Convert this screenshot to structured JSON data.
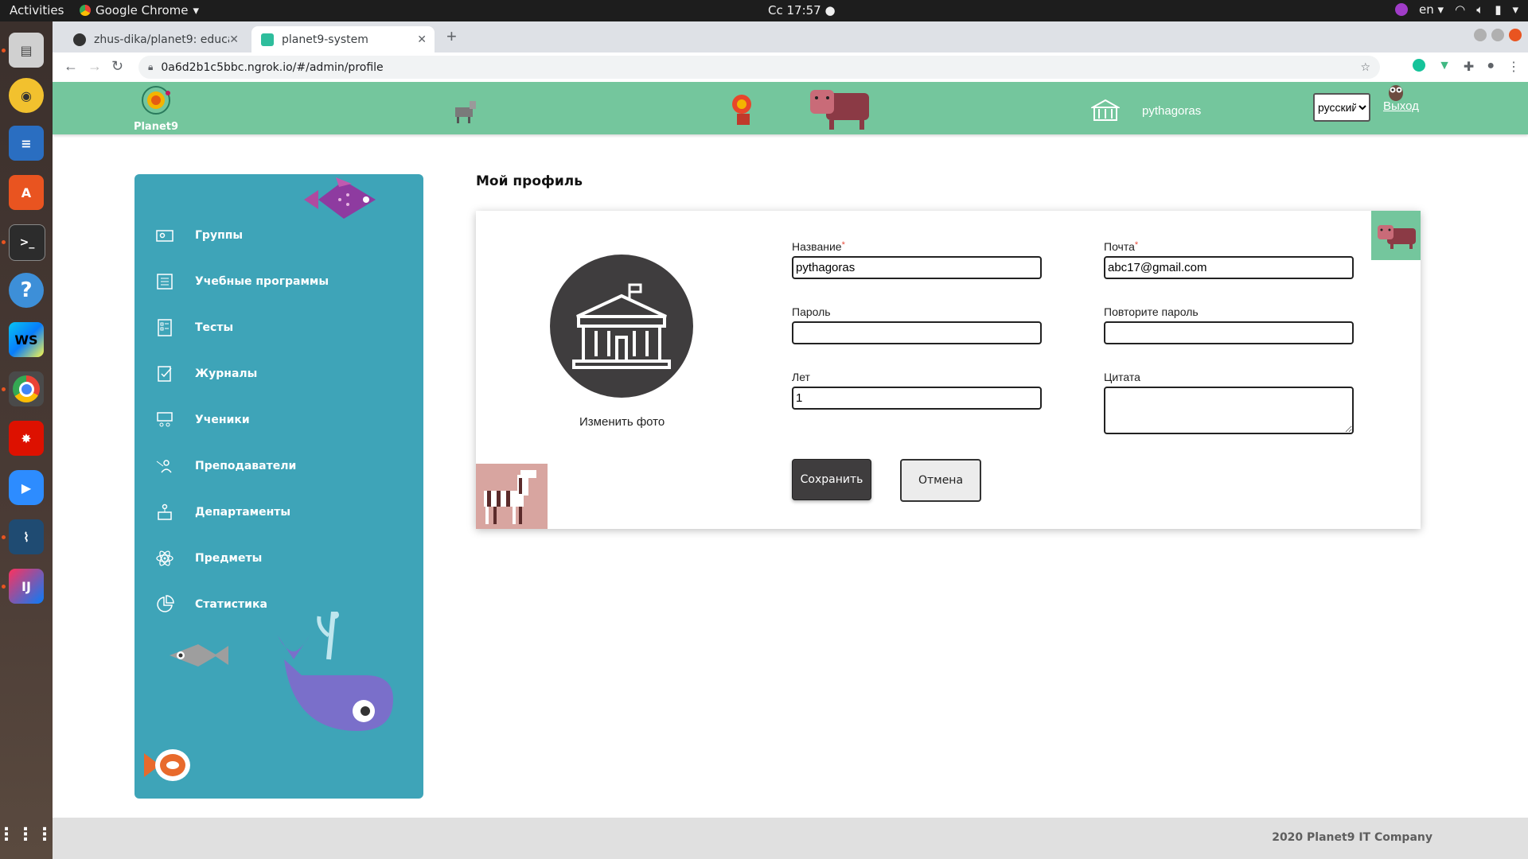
{
  "os": {
    "activities": "Activities",
    "app_name": "Google Chrome",
    "clock": "Сс 17:57",
    "language": "en"
  },
  "browser": {
    "tabs": [
      {
        "title": "zhus-dika/planet9: educa",
        "active": false
      },
      {
        "title": "planet9-system",
        "active": true
      }
    ],
    "url": "0a6d2b1c5bbc.ngrok.io/#/admin/profile"
  },
  "header": {
    "logo_text": "Planet9",
    "username": "pythagoras",
    "language_select": "русский",
    "logout": "Выход"
  },
  "sidebar": {
    "items": [
      {
        "label": "Группы",
        "icon": "groups-icon"
      },
      {
        "label": "Учебные программы",
        "icon": "curriculum-icon"
      },
      {
        "label": "Тесты",
        "icon": "tests-icon"
      },
      {
        "label": "Журналы",
        "icon": "journals-icon"
      },
      {
        "label": "Ученики",
        "icon": "students-icon"
      },
      {
        "label": "Преподаватели",
        "icon": "teachers-icon"
      },
      {
        "label": "Департаменты",
        "icon": "departments-icon"
      },
      {
        "label": "Предметы",
        "icon": "subjects-icon"
      },
      {
        "label": "Статистика",
        "icon": "statistics-icon"
      }
    ]
  },
  "page": {
    "title": "Мой профиль",
    "change_photo": "Изменить фото",
    "form": {
      "name_label": "Название",
      "name_value": "pythagoras",
      "email_label": "Почта",
      "email_value": "abc17@gmail.com",
      "password_label": "Пароль",
      "password_value": "",
      "repeat_password_label": "Повторите пароль",
      "repeat_password_value": "",
      "age_label": "Лет",
      "age_value": "1",
      "quote_label": "Цитата",
      "quote_value": "",
      "required_mark": "*",
      "save_button": "Сохранить",
      "cancel_button": "Отмена"
    }
  },
  "footer": {
    "copyright": "2020 Planet9 IT Company"
  },
  "colors": {
    "header_bg": "#74c69d",
    "sidebar_bg": "#3ea4b8",
    "avatar_bg": "#3f3d3e",
    "footer_bg": "#e0e0e0"
  }
}
